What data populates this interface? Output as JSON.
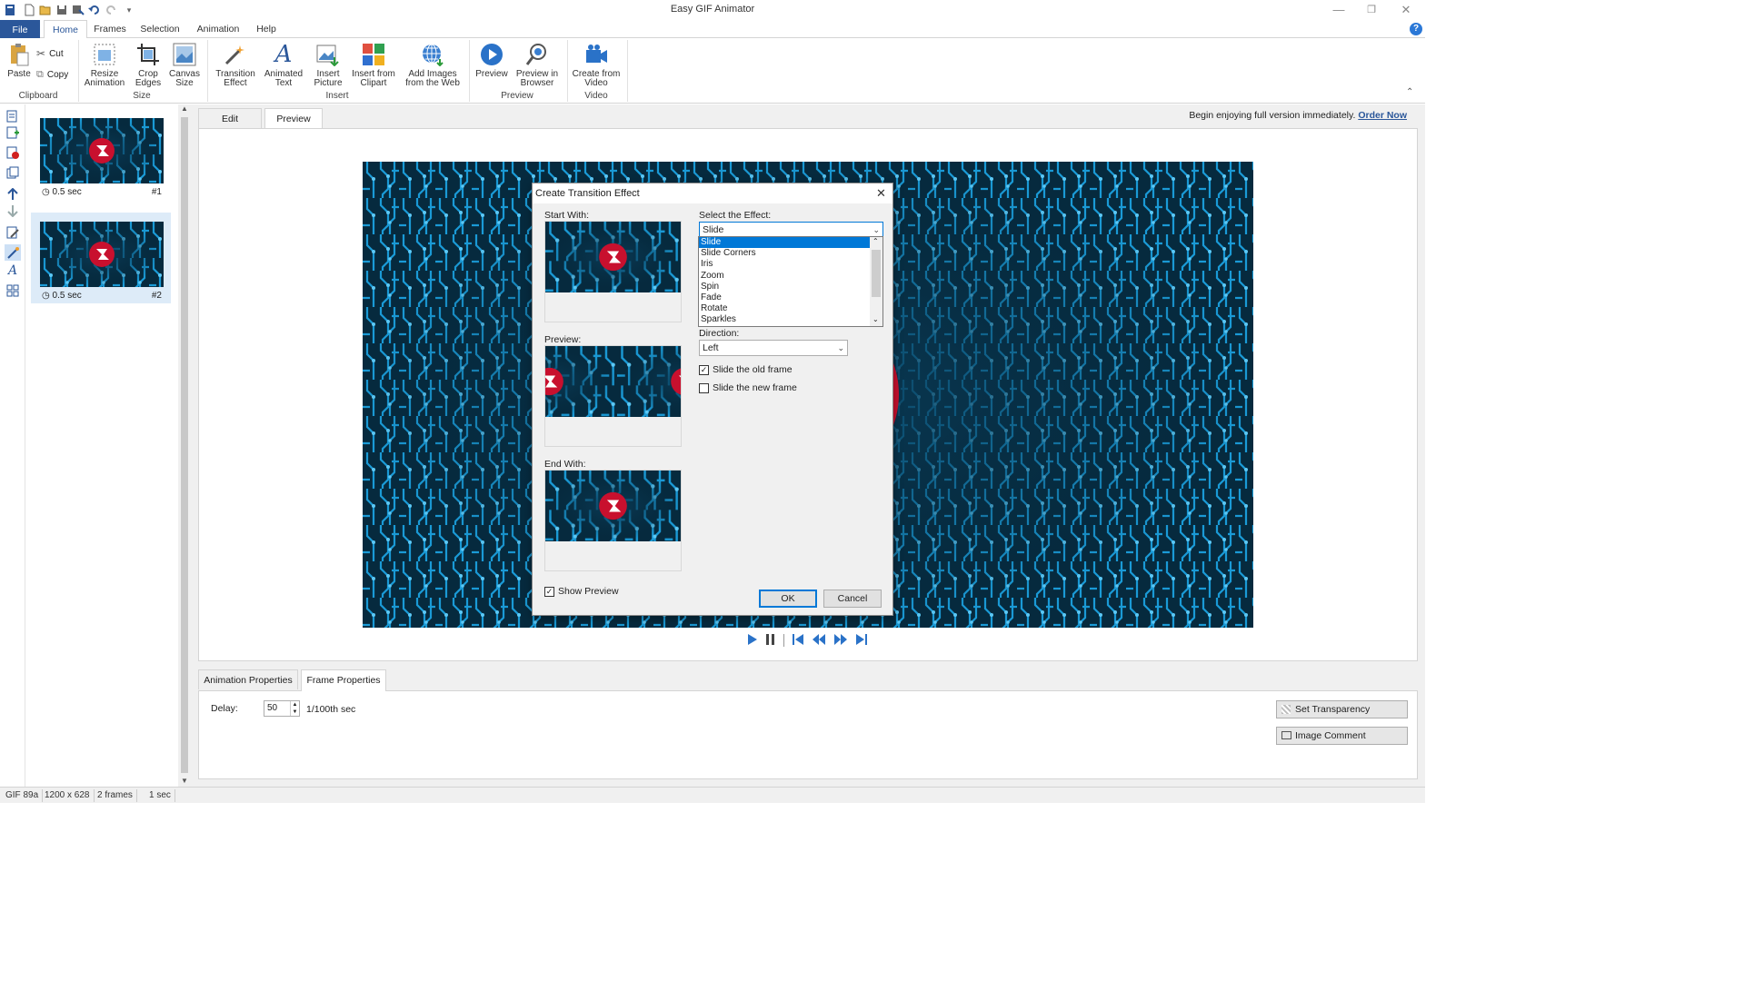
{
  "app": {
    "title": "Easy GIF Animator"
  },
  "ribbon_tabs": [
    {
      "label": "File"
    },
    {
      "label": "Home"
    },
    {
      "label": "Frames"
    },
    {
      "label": "Selection"
    },
    {
      "label": "Animation"
    },
    {
      "label": "Help"
    }
  ],
  "ribbon": {
    "clipboard": {
      "paste": "Paste",
      "cut": "Cut",
      "copy": "Copy",
      "group": "Clipboard"
    },
    "size": {
      "resize": "Resize Animation",
      "crop": "Crop Edges",
      "canvas": "Canvas Size",
      "group": "Size"
    },
    "insert": {
      "transition": "Transition Effect",
      "text": "Animated Text",
      "picture": "Insert Picture",
      "clipart": "Insert from Clipart",
      "web": "Add Images from the Web",
      "group": "Insert"
    },
    "preview": {
      "preview": "Preview",
      "browser": "Preview in Browser",
      "group": "Preview"
    },
    "video": {
      "create": "Create from Video",
      "group": "Video"
    }
  },
  "frames": [
    {
      "duration": "0.5 sec",
      "number": "#1"
    },
    {
      "duration": "0.5 sec",
      "number": "#2"
    }
  ],
  "editor_tabs": [
    {
      "label": "Edit"
    },
    {
      "label": "Preview"
    }
  ],
  "promo": {
    "text": "Begin enjoying full version immediately.",
    "link": "Order Now"
  },
  "props_tabs": [
    {
      "label": "Animation Properties"
    },
    {
      "label": "Frame Properties"
    }
  ],
  "frame_props": {
    "delay_label": "Delay:",
    "delay_value": "50",
    "delay_unit": "1/100th sec",
    "set_transparency": "Set Transparency",
    "image_comment": "Image Comment"
  },
  "status": {
    "format": "GIF 89a",
    "size": "1200 x 628",
    "frames": "2 frames",
    "duration": "1 sec"
  },
  "dialog": {
    "title": "Create Transition Effect",
    "start_label": "Start With:",
    "preview_label": "Preview:",
    "end_label": "End With:",
    "effect_label": "Select the Effect:",
    "effect_selected": "Slide",
    "effect_options": [
      "Slide",
      "Slide Corners",
      "Iris",
      "Zoom",
      "Spin",
      "Fade",
      "Rotate",
      "Sparkles"
    ],
    "direction_label": "Direction:",
    "direction_value": "Left",
    "slide_old": "Slide the old frame",
    "slide_old_checked": true,
    "slide_new": "Slide the new frame",
    "slide_new_checked": false,
    "show_preview": "Show Preview",
    "show_preview_checked": true,
    "ok": "OK",
    "cancel": "Cancel"
  },
  "colors": {
    "accent": "#2b579a",
    "selection": "#0078d7",
    "circuit_bg": "#062a3e",
    "circuit_line": "#1a9ad6",
    "logo_red": "#c8102e"
  }
}
